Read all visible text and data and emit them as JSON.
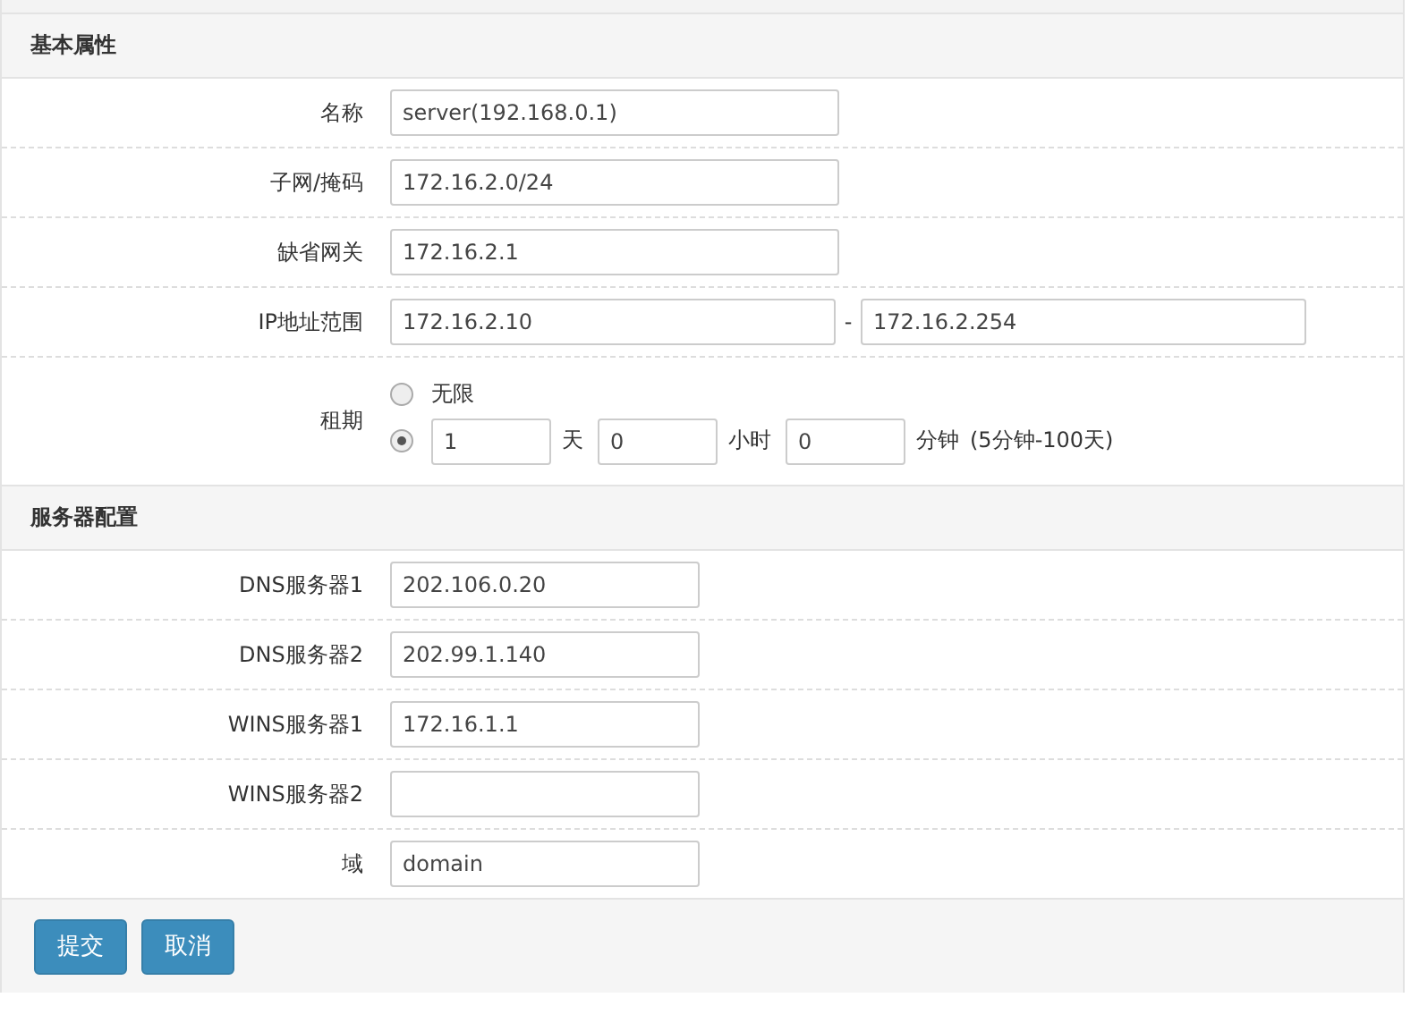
{
  "sections": [
    {
      "title": "基本属性",
      "fields": [
        {
          "kind": "text",
          "label": "名称",
          "value": "server(192.168.0.1)"
        },
        {
          "kind": "text",
          "label": "子网/掩码",
          "value": "172.16.2.0/24"
        },
        {
          "kind": "text",
          "label": "缺省网关",
          "value": "172.16.2.1"
        },
        {
          "kind": "range",
          "label": "IP地址范围",
          "from": "172.16.2.10",
          "separator": "-",
          "to": "172.16.2.254"
        },
        {
          "kind": "lease",
          "label": "租期",
          "options": [
            {
              "kind": "plain",
              "label": "无限",
              "selected": false
            },
            {
              "kind": "duration",
              "selected": true,
              "parts": [
                {
                  "value": "1",
                  "unit": "天"
                },
                {
                  "value": "0",
                  "unit": "小时"
                },
                {
                  "value": "0",
                  "unit": "分钟"
                }
              ],
              "hint": "(5分钟-100天)"
            }
          ]
        }
      ]
    },
    {
      "title": "服务器配置",
      "fields": [
        {
          "kind": "short",
          "label": "DNS服务器1",
          "value": "202.106.0.20"
        },
        {
          "kind": "short",
          "label": "DNS服务器2",
          "value": "202.99.1.140"
        },
        {
          "kind": "short",
          "label": "WINS服务器1",
          "value": "172.16.1.1"
        },
        {
          "kind": "short",
          "label": "WINS服务器2"
        },
        {
          "kind": "short",
          "label": "域",
          "value": "domain"
        }
      ]
    }
  ],
  "buttons": [
    {
      "label": "提交"
    },
    {
      "label": "取消"
    }
  ]
}
